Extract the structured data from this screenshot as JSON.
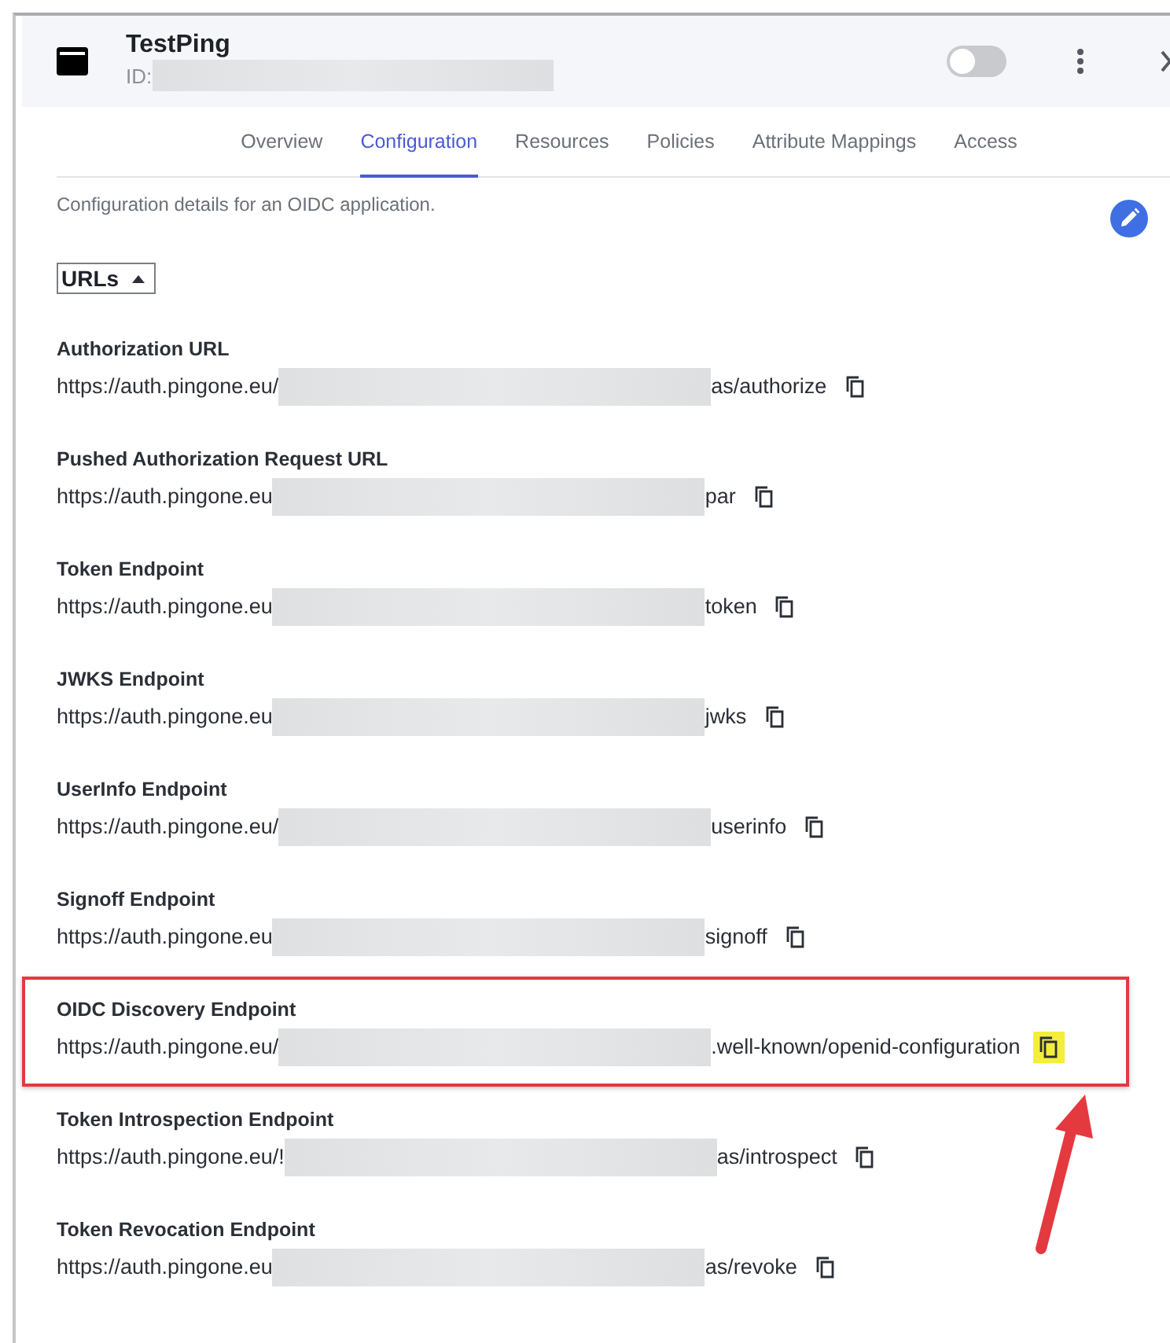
{
  "app": {
    "title": "TestPing",
    "id_label": "ID:",
    "enabled": false
  },
  "tabs": [
    {
      "label": "Overview",
      "selected": false
    },
    {
      "label": "Configuration",
      "selected": true
    },
    {
      "label": "Resources",
      "selected": false
    },
    {
      "label": "Policies",
      "selected": false
    },
    {
      "label": "Attribute Mappings",
      "selected": false
    },
    {
      "label": "Access",
      "selected": false
    }
  ],
  "description": "Configuration details for an OIDC application.",
  "section": {
    "label": "URLs",
    "expanded": true
  },
  "urls": [
    {
      "label": "Authorization URL",
      "prefix": "https://auth.pingone.eu/",
      "suffix": "as/authorize",
      "highlighted": false
    },
    {
      "label": "Pushed Authorization Request URL",
      "prefix": "https://auth.pingone.eu",
      "suffix": "par",
      "highlighted": false
    },
    {
      "label": "Token Endpoint",
      "prefix": "https://auth.pingone.eu",
      "suffix": "token",
      "highlighted": false
    },
    {
      "label": "JWKS Endpoint",
      "prefix": "https://auth.pingone.eu",
      "suffix": "jwks",
      "highlighted": false
    },
    {
      "label": "UserInfo Endpoint",
      "prefix": "https://auth.pingone.eu/",
      "suffix": "userinfo",
      "highlighted": false
    },
    {
      "label": "Signoff Endpoint",
      "prefix": "https://auth.pingone.eu",
      "suffix": "signoff",
      "highlighted": false
    },
    {
      "label": "OIDC Discovery Endpoint",
      "prefix": "https://auth.pingone.eu/",
      "suffix": ".well-known/openid-configuration",
      "highlighted": true
    },
    {
      "label": "Token Introspection Endpoint",
      "prefix": "https://auth.pingone.eu/!",
      "suffix": "as/introspect",
      "highlighted": false
    },
    {
      "label": "Token Revocation Endpoint",
      "prefix": "https://auth.pingone.eu",
      "suffix": "as/revoke",
      "highlighted": false
    }
  ]
}
